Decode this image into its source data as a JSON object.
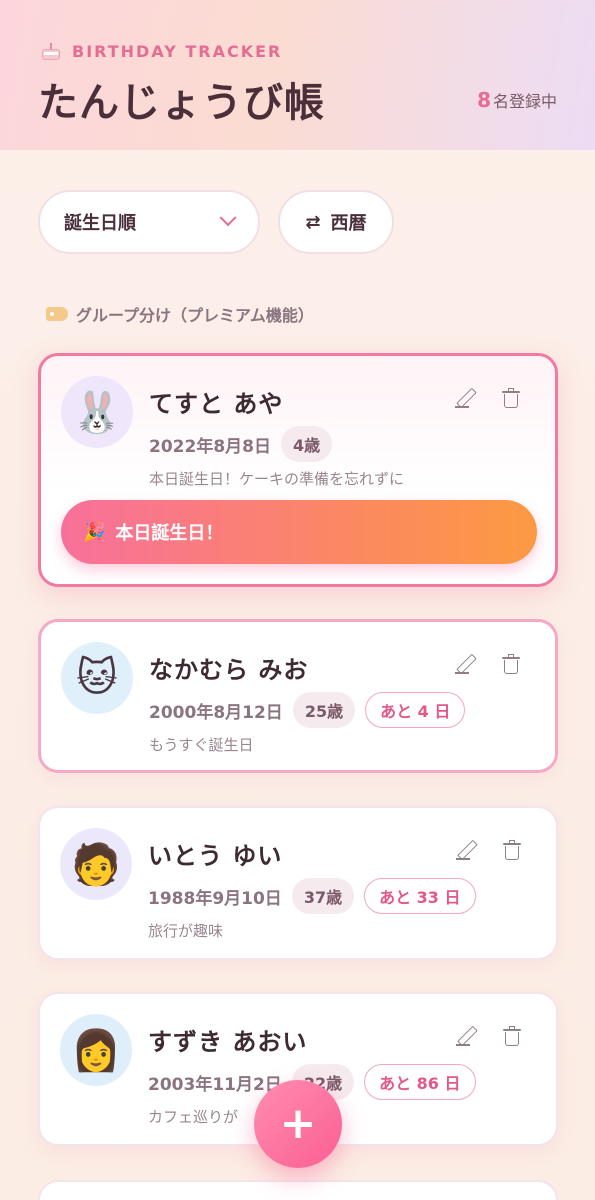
{
  "header": {
    "subtitle": "BIRTHDAY TRACKER",
    "title": "たんじょうび帳",
    "count_number": "8",
    "count_suffix": "名登録中"
  },
  "controls": {
    "sort_label": "誕生日順",
    "era_label": "西暦",
    "group_label": "グループ分け（プレミアム機能）"
  },
  "cards": [
    {
      "avatar": "🐰",
      "name": "てすと あや",
      "birth": "2022年8月8日",
      "age": "4歳",
      "note": "本日誕生日！ケーキの準備を忘れずに",
      "banner": "本日誕生日！",
      "banner_icon": "🎉"
    },
    {
      "avatar": "🐱",
      "name": "なかむら みお",
      "birth": "2000年8月12日",
      "age": "25歳",
      "days": "あと 4 日",
      "note": "もうすぐ誕生日"
    },
    {
      "avatar": "🧑",
      "name": "いとう ゆい",
      "birth": "1988年9月10日",
      "age": "37歳",
      "days": "あと 33 日",
      "note": "旅行が趣味"
    },
    {
      "avatar": "👩",
      "name": "すずき あおい",
      "birth": "2003年11月2日",
      "age": "22歳",
      "days": "あと 86 日",
      "note": "カフェ巡りが"
    }
  ],
  "fab_label": "+",
  "colors": {
    "accent": "#e56d93",
    "banner_start": "#f8709b",
    "banner_end": "#fc9a42"
  }
}
